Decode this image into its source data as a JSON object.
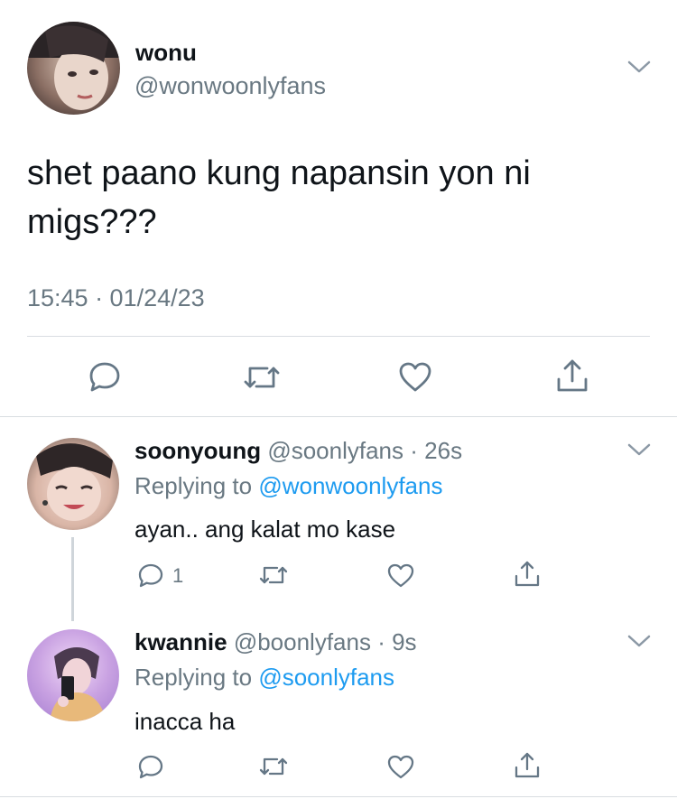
{
  "main_tweet": {
    "display_name": "wonu",
    "handle": "@wonwoonlyfans",
    "text_line1": "shet paano kung napansin yon ni",
    "text_line2": "migs???",
    "timestamp": "15:45 · 01/24/23",
    "actions": [
      "reply-icon",
      "retweet-icon",
      "like-icon",
      "share-icon"
    ]
  },
  "replies": [
    {
      "display_name": "soonyoung",
      "handle": "@soonlyfans",
      "time": "· 26s",
      "replying_label": "Replying to",
      "replying_to": "@wonwoonlyfans",
      "text": "ayan.. ang kalat mo kase",
      "reply_count": "1"
    },
    {
      "display_name": "kwannie",
      "handle": "@boonlyfans",
      "time": "· 9s",
      "replying_label": "Replying to",
      "replying_to": "@soonlyfans",
      "text": "inacca ha"
    }
  ],
  "colors": {
    "link": "#1d9bf0",
    "muted": "#697882",
    "text": "#0f1419",
    "divider": "#d9dde1"
  }
}
